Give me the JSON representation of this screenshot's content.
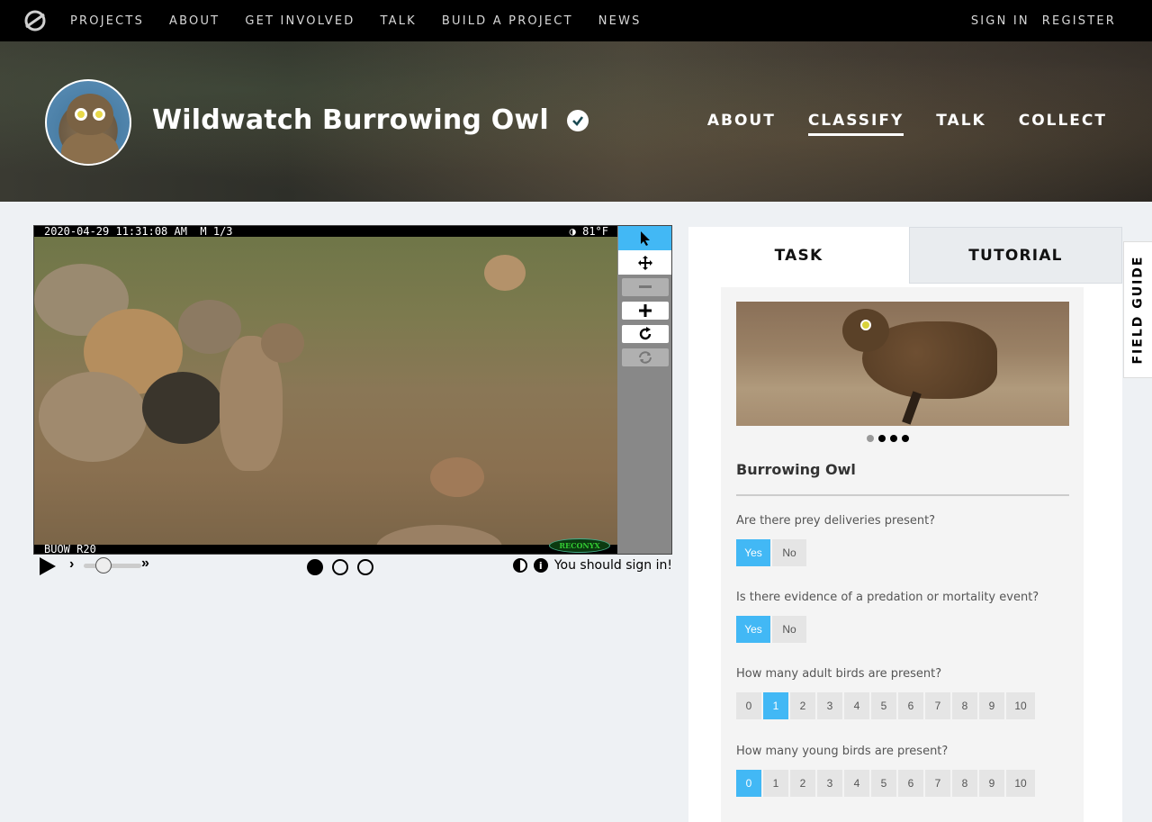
{
  "topnav": {
    "logo_icon": "zooniverse-logo-icon",
    "links": [
      "PROJECTS",
      "ABOUT",
      "GET INVOLVED",
      "TALK",
      "BUILD A PROJECT",
      "NEWS"
    ],
    "sign_in": "SIGN IN",
    "register": "REGISTER"
  },
  "project": {
    "title": "Wildwatch Burrowing Owl",
    "verified_icon": "verified-check-icon",
    "nav": [
      "ABOUT",
      "CLASSIFY",
      "TALK",
      "COLLECT"
    ],
    "active_nav": "CLASSIFY"
  },
  "subject": {
    "timestamp": "2020-04-29 11:31:08 AM  M 1/3",
    "temperature": "◑  81°F",
    "camera_label": "BUOW R20",
    "brand": "RECONYX",
    "frames": 3,
    "current_frame": 1
  },
  "controls": {
    "play_icon": "play-icon",
    "slower_icon": "chevron-right-icon",
    "faster_icon": "double-chevron-right-icon",
    "signin_message": "You should sign in!",
    "contrast_icon": "contrast-icon",
    "info_icon": "info-icon"
  },
  "tools": [
    "pointer-icon",
    "pan-icon",
    "zoom-out-icon",
    "zoom-in-icon",
    "rotate-icon",
    "reset-icon"
  ],
  "task": {
    "tabs": [
      "TASK",
      "TUTORIAL"
    ],
    "species_name": "Burrowing Owl",
    "carousel_count": 4,
    "questions": [
      {
        "text": "Are there prey deliveries present?",
        "answers": [
          "Yes",
          "No"
        ],
        "selected": "Yes"
      },
      {
        "text": "Is there evidence of a predation or mortality event?",
        "answers": [
          "Yes",
          "No"
        ],
        "selected": "Yes"
      },
      {
        "text": "How many adult birds are present?",
        "answers": [
          "0",
          "1",
          "2",
          "3",
          "4",
          "5",
          "6",
          "7",
          "8",
          "9",
          "10"
        ],
        "selected": "1"
      },
      {
        "text": "How many young birds are present?",
        "answers": [
          "0",
          "1",
          "2",
          "3",
          "4",
          "5",
          "6",
          "7",
          "8",
          "9",
          "10"
        ],
        "selected": "0"
      }
    ]
  },
  "field_guide": {
    "label": "FIELD GUIDE"
  },
  "colors": {
    "accent": "#42b8f5",
    "nav_bg": "#000000",
    "page_bg": "#eef1f4"
  }
}
